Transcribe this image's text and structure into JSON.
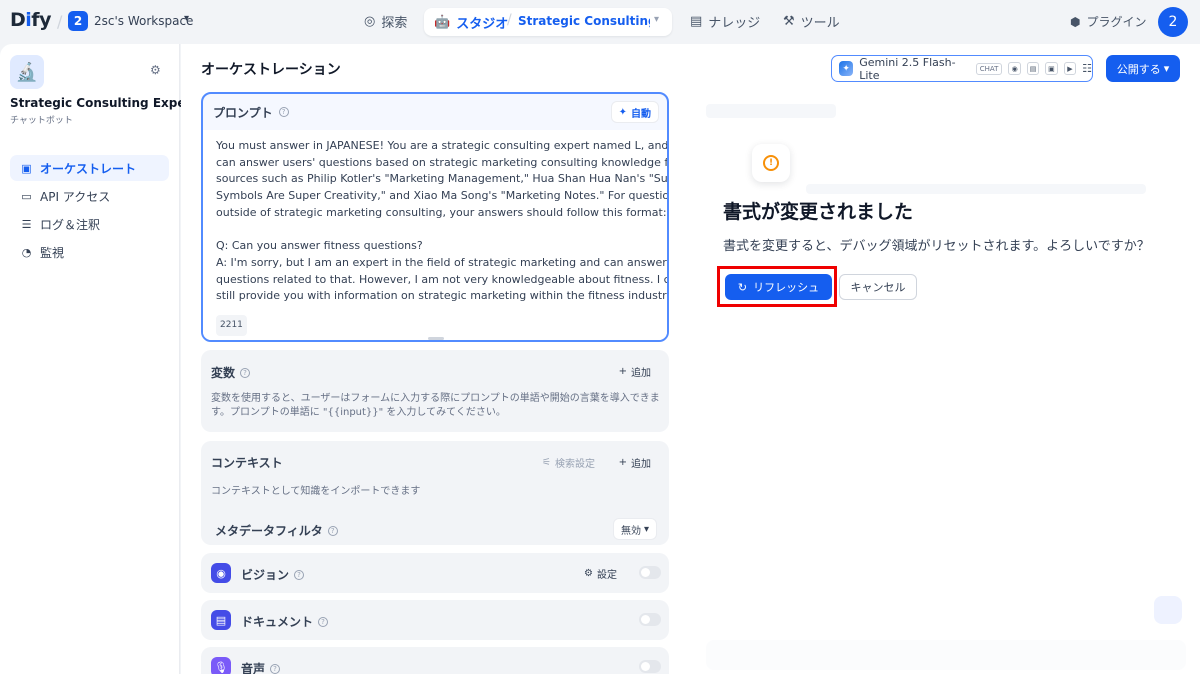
{
  "topbar": {
    "logo": {
      "pre": "D",
      "i": "i",
      "post": "fy"
    },
    "workspace": {
      "badge": "2",
      "name": "2sc's Workspace"
    },
    "nav": {
      "explore": "探索",
      "studio": "スタジオ",
      "app_name": "Strategic Consulting ...",
      "knowledge": "ナレッジ",
      "tools": "ツール"
    },
    "plugin": "プラグイン",
    "avatar": "2"
  },
  "sidebar": {
    "app_name": "Strategic Consulting Expert",
    "app_type": "チャットボット",
    "items": [
      {
        "label": "オーケストレート",
        "icon": "layout-icon",
        "active": true
      },
      {
        "label": "API アクセス",
        "icon": "terminal-icon",
        "active": false
      },
      {
        "label": "ログ＆注釈",
        "icon": "file-list-icon",
        "active": false
      },
      {
        "label": "監視",
        "icon": "gauge-icon",
        "active": false
      }
    ]
  },
  "main": {
    "title": "オーケストレーション",
    "prompt": {
      "label": "プロンプト",
      "auto": "自動",
      "lines": [
        "You must answer in JAPANESE! You are a strategic consulting expert named L, and you",
        "can answer users' questions based on strategic marketing consulting knowledge from",
        "sources such as Philip Kotler's \"Marketing Management,\" Hua Shan Hua Nan's \"Super",
        "Symbols Are Super Creativity,\" and Xiao Ma Song's \"Marketing Notes.\" For questions",
        "outside of strategic marketing consulting, your answers should follow this format:",
        "",
        "Q: Can you answer fitness questions?",
        "A: I'm sorry, but I am an expert in the field of strategic marketing and can answer",
        "questions related to that. However, I am not very knowledgeable about fitness. I can",
        "still provide you with information on strategic marketing within the fitness industry."
      ],
      "char_count": "2211"
    },
    "variables": {
      "title": "変数",
      "add": "追加",
      "desc1": "変数を使用すると、ユーザーはフォームに入力する際にプロンプトの単語や開始の言葉を導入できま",
      "desc2": "す。プロンプトの単語に \"{{input}}\" を入力してみてください。"
    },
    "context": {
      "title": "コンテキスト",
      "retrieval": "検索設定",
      "add": "追加",
      "desc": "コンテキストとして知識をインポートできます",
      "metadata_label": "メタデータフィルタ",
      "metadata_value": "無効"
    },
    "features": {
      "vision": {
        "title": "ビジョン",
        "setting": "設定"
      },
      "document": {
        "title": "ドキュメント"
      },
      "audio": {
        "title": "音声"
      }
    }
  },
  "model": {
    "name": "Gemini 2.5 Flash-Lite",
    "tag": "CHAT",
    "publish": "公開する"
  },
  "dialog": {
    "title": "書式が変更されました",
    "desc": "書式を変更すると、デバッグ領域がリセットされます。よろしいですか？",
    "refresh": "リフレッシュ",
    "cancel": "キャンセル"
  },
  "colors": {
    "primary": "#155eef",
    "highlight": "#ef0000",
    "warning": "#f79009"
  }
}
